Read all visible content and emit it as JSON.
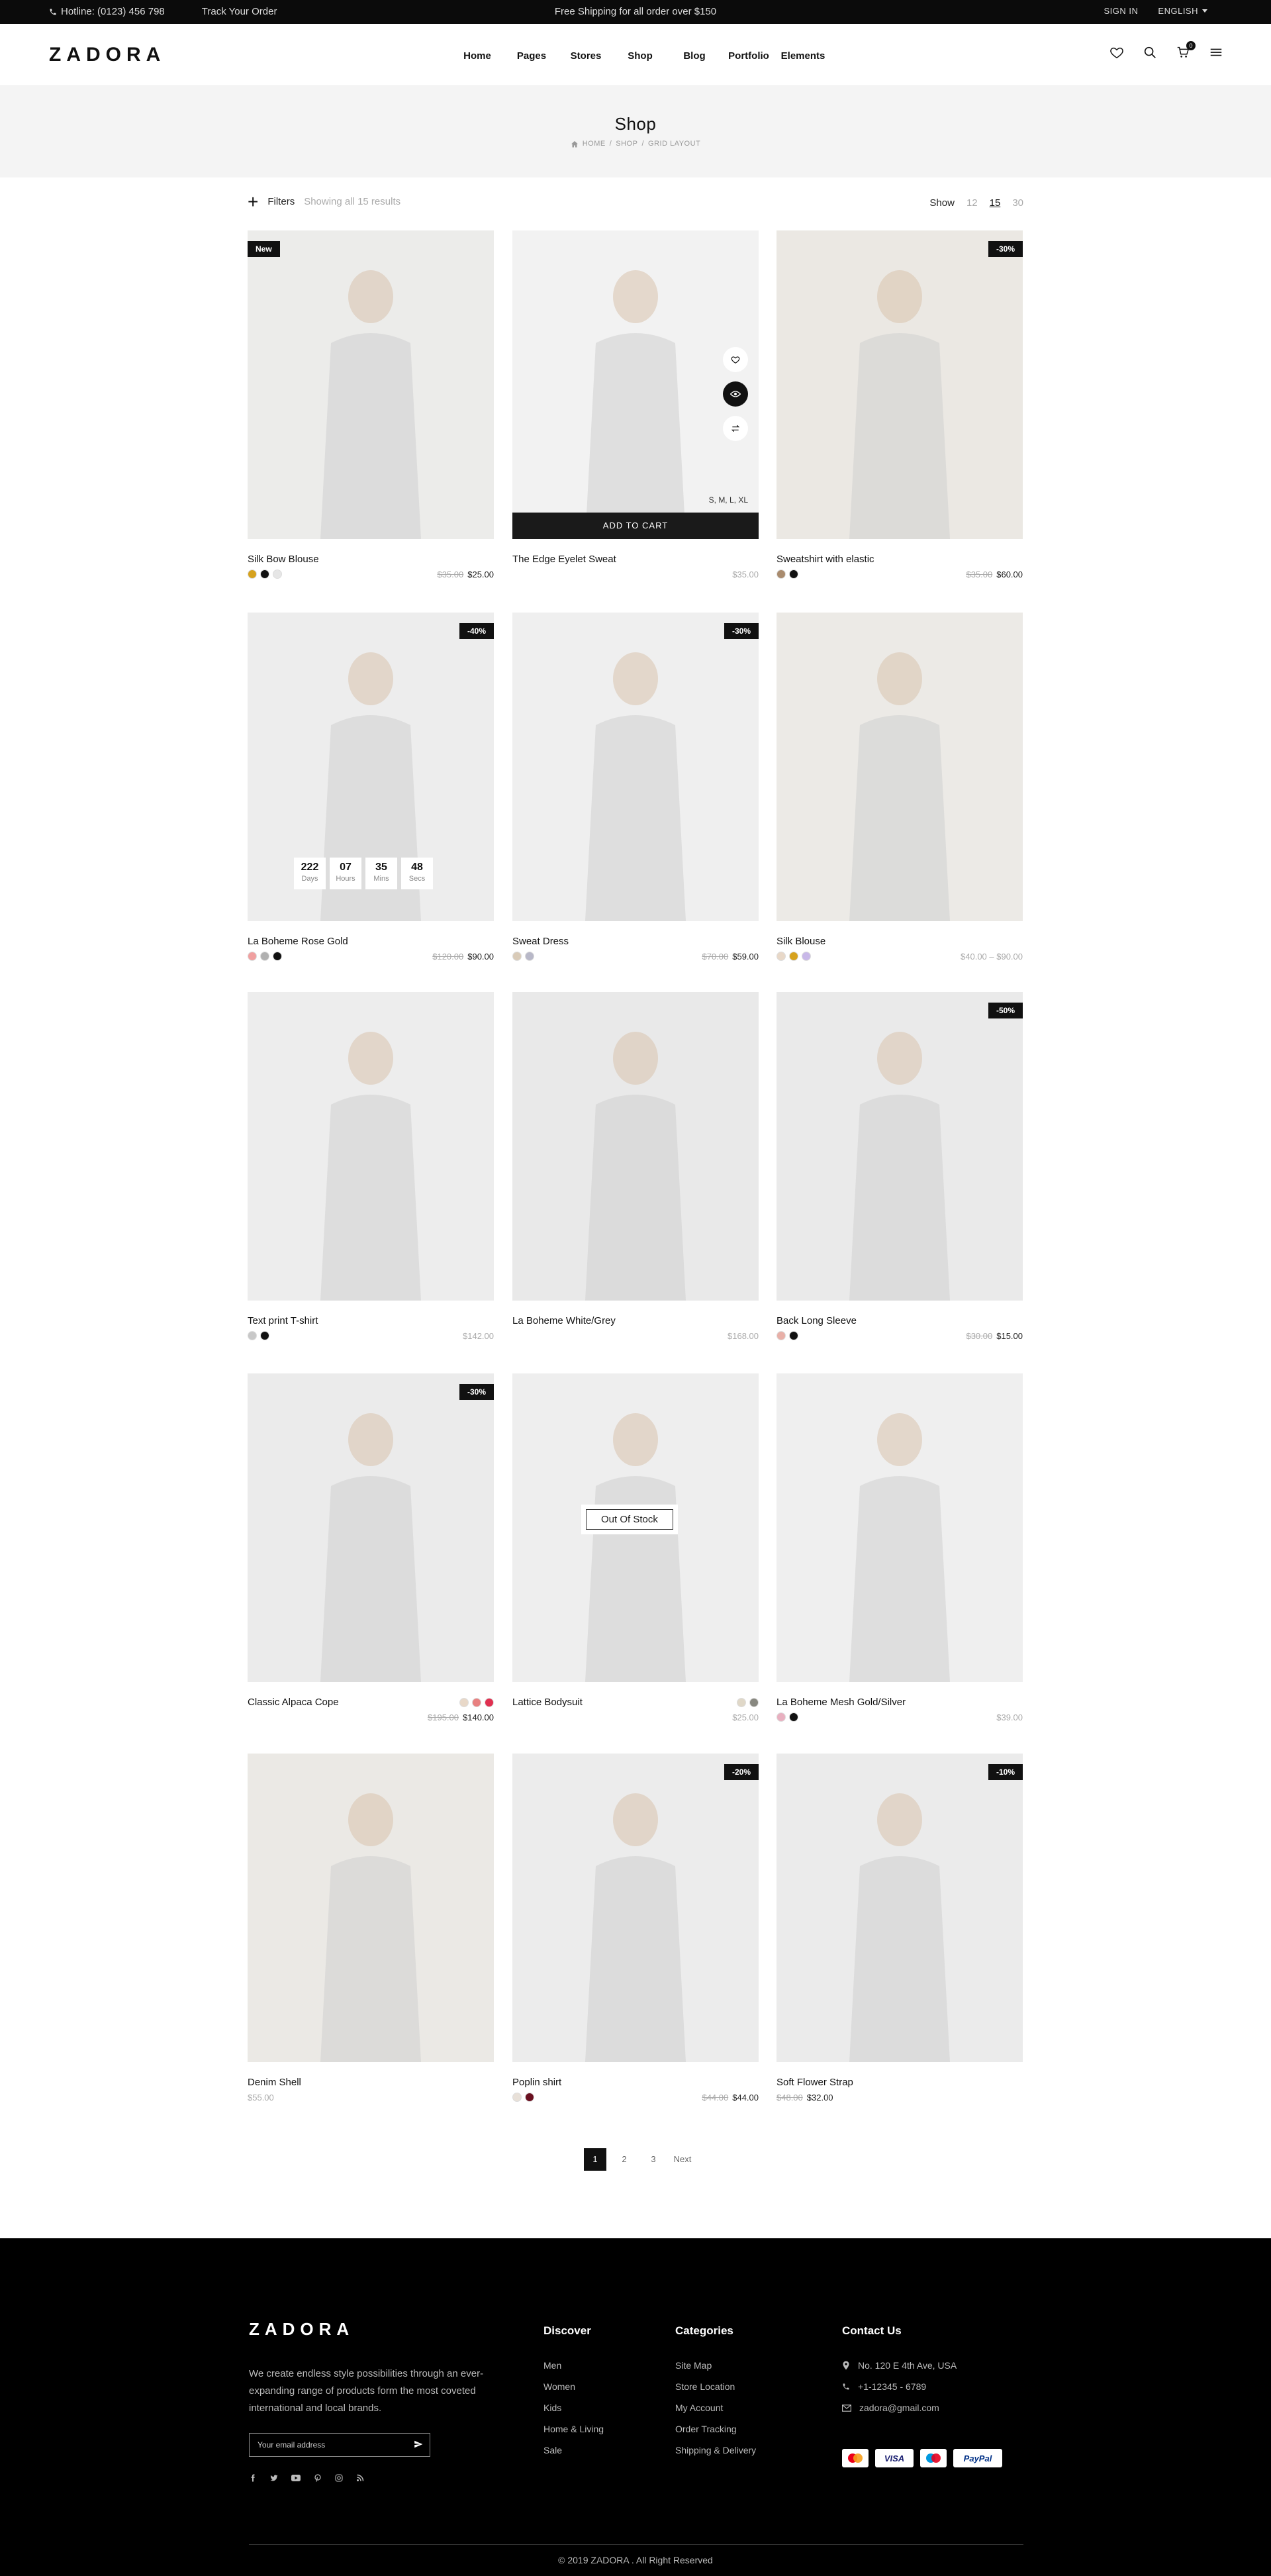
{
  "topbar": {
    "hotline": "Hotline: (0123) 456 798",
    "track": "Track Your Order",
    "promo": "Free Shipping for all order over $150",
    "signin": "SIGN IN",
    "language": "ENGLISH"
  },
  "header": {
    "logo": "ZADORA",
    "nav": [
      "Home",
      "Pages",
      "Stores",
      "Shop",
      "Blog",
      "Portfolio",
      "Elements"
    ],
    "cart_count": "0"
  },
  "titleband": {
    "title": "Shop",
    "crumbs": [
      "HOME",
      "/",
      "SHOP",
      "/",
      "GRID LAYOUT"
    ]
  },
  "toolbar": {
    "filters": "Filters",
    "results": "Showing all 15 results",
    "show_label": "Show",
    "show_options": [
      "12",
      "15",
      "30"
    ],
    "show_selected": "15"
  },
  "products": [
    {
      "name": "Silk Bow Blouse",
      "old": "$35.00",
      "price": "$25.00",
      "badge": "New",
      "badge_side": "left",
      "swatches": [
        "#d6a21e",
        "#111111",
        "#e6e6e6"
      ],
      "bg": "#ececea"
    },
    {
      "name": "The Edge Eyelet Sweat",
      "old": "",
      "price": "$35.00",
      "price_muted": true,
      "badge": "",
      "swatches": [],
      "bg": "#f2f2f2",
      "hover": true,
      "add_to_cart": "ADD TO CART",
      "sizes": "S, M, L, XL"
    },
    {
      "name": "Sweatshirt with elastic",
      "old": "$35.00",
      "price": "$60.00",
      "badge": "-30%",
      "swatches": [
        "#a98b6e",
        "#111111"
      ],
      "bg": "#ebe8e3"
    },
    {
      "name": "La Boheme Rose Gold",
      "old": "$120.00",
      "price": "$90.00",
      "badge": "-40%",
      "swatches": [
        "#f0a0a0",
        "#b0b0b0",
        "#111111"
      ],
      "bg": "#ededed",
      "countdown": [
        {
          "v": "222",
          "l": "Days"
        },
        {
          "v": "07",
          "l": "Hours"
        },
        {
          "v": "35",
          "l": "Mins"
        },
        {
          "v": "48",
          "l": "Secs"
        }
      ]
    },
    {
      "name": "Sweat Dress",
      "old": "$70.00",
      "price": "$59.00",
      "badge": "-30%",
      "swatches": [
        "#d9cbb8",
        "#b8b8c8"
      ],
      "bg": "#efefef"
    },
    {
      "name": "Silk Blouse",
      "old": "",
      "price": "$40.00 – $90.00",
      "price_muted": true,
      "badge": "",
      "swatches": [
        "#e8d8c8",
        "#d6a21e",
        "#c8b8e8"
      ],
      "bg": "#eceae6"
    },
    {
      "name": "Text print T-shirt",
      "old": "",
      "price": "$142.00",
      "price_muted": true,
      "badge": "",
      "swatches": [
        "#c8c8c8",
        "#111111"
      ],
      "bg": "#ededed"
    },
    {
      "name": "La Boheme White/Grey",
      "old": "",
      "price": "$168.00",
      "price_muted": true,
      "badge": "",
      "swatches": [],
      "bg": "#e9e9e9"
    },
    {
      "name": "Back Long Sleeve",
      "old": "$30.00",
      "price": "$15.00",
      "badge": "-50%",
      "swatches": [
        "#e8b0a8",
        "#111111"
      ],
      "bg": "#eaeaea"
    },
    {
      "name": "Classic Alpaca Cope",
      "old": "$195.00",
      "price": "$140.00",
      "badge": "-30%",
      "swatches": [
        "#e8d8c8",
        "#e88080",
        "#e03050"
      ],
      "swatch_side": "right",
      "bg": "#ebebeb"
    },
    {
      "name": "Lattice Bodysuit",
      "old": "",
      "price": "$25.00",
      "price_muted": true,
      "badge": "",
      "swatches": [
        "#e0d8c8",
        "#888880"
      ],
      "swatch_side": "right",
      "bg": "#eeeeee",
      "out_of_stock": "Out Of Stock"
    },
    {
      "name": "La Boheme Mesh Gold/Silver",
      "old": "",
      "price": "$39.00",
      "price_muted": true,
      "badge": "",
      "swatches": [
        "#e8b0c0",
        "#111111"
      ],
      "bg": "#efefef"
    },
    {
      "name": "Denim Shell",
      "old": "",
      "price": "$55.00",
      "price_muted": true,
      "price_left": true,
      "badge": "",
      "swatches": [],
      "bg": "#ebe9e5"
    },
    {
      "name": "Poplin shirt",
      "old": "$44.00",
      "price": "$44.00",
      "badge": "-20%",
      "swatches": [
        "#e8e0d8",
        "#6a1020"
      ],
      "bg": "#ececec"
    },
    {
      "name": "Soft Flower Strap",
      "old": "$48.00",
      "price": "$32.00",
      "badge": "-10%",
      "price_left": true,
      "swatches": [],
      "bg": "#ebebeb"
    }
  ],
  "pagination": {
    "pages": [
      "1",
      "2",
      "3"
    ],
    "current": "1",
    "next": "Next"
  },
  "footer": {
    "logo": "ZADORA",
    "about": "We create endless style possibilities through an ever-expanding range of products form the most coveted international and local brands.",
    "newsletter_placeholder": "Your email address",
    "social": [
      "f",
      "t",
      "yt",
      "p",
      "ig",
      "rss"
    ],
    "discover": {
      "title": "Discover",
      "links": [
        "Men",
        "Women",
        "Kids",
        "Home & Living",
        "Sale"
      ]
    },
    "categories": {
      "title": "Categories",
      "links": [
        "Site Map",
        "Store Location",
        "My Account",
        "Order Tracking",
        "Shipping & Delivery"
      ]
    },
    "contact": {
      "title": "Contact Us",
      "address": "No. 120 E 4th Ave,  USA",
      "phone": "+1-12345 - 6789",
      "email": "zadora@gmail.com"
    },
    "payments": [
      "MasterCard",
      "VISA",
      "Maestro",
      "PayPal"
    ],
    "copyright": "© 2019 ZADORA . All Right Reserved"
  }
}
